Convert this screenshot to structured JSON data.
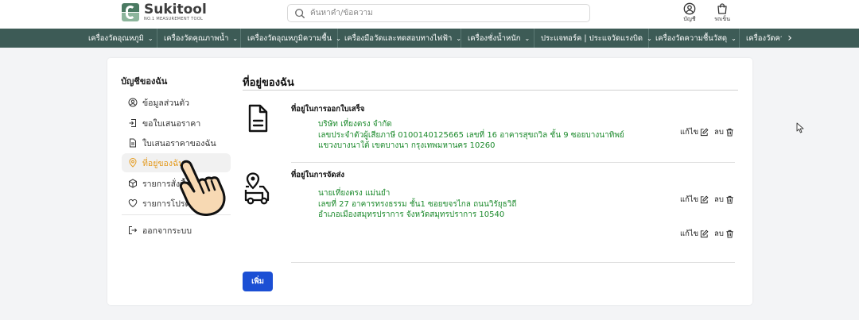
{
  "brand": {
    "name": "Sukitool",
    "tagline": "NO.1 MEASUREMENT TOOL"
  },
  "search": {
    "placeholder": "ค้นหาคำ/ข้อความ"
  },
  "header_icons": {
    "account_label": "บัญชี",
    "cart_label": "รถเข็น"
  },
  "nav": {
    "items": [
      {
        "label": "เครื่องวัดอุณหภูมิ"
      },
      {
        "label": "เครื่องวัดคุณภาพน้ำ"
      },
      {
        "label": "เครื่องวัดอุณหภูมิความชื้น"
      },
      {
        "label": "เครื่องมือวัดและทดสอบทางไฟฟ้า"
      },
      {
        "label": "เครื่องชั่งน้ำหนัก"
      },
      {
        "label": "ประแจทอร์ค | ประแจวัดแรงบิด"
      },
      {
        "label": "เครื่องวัดความชื้นวัสดุ"
      },
      {
        "label": "เครื่องวัดควา"
      }
    ]
  },
  "sidebar": {
    "title": "บัญชีของฉัน",
    "items": [
      {
        "label": "ข้อมูลส่วนตัว",
        "icon": "user-circle-icon"
      },
      {
        "label": "ขอใบเสนอราคา",
        "icon": "quote-request-icon"
      },
      {
        "label": "ใบเสนอราคาของฉัน",
        "icon": "document-icon"
      },
      {
        "label": "ที่อยู่ของฉัน",
        "icon": "location-pin-icon",
        "active": true
      },
      {
        "label": "รายการสั่งซื้อ",
        "icon": "box-icon"
      },
      {
        "label": "รายการโปรด",
        "icon": "heart-icon"
      },
      {
        "label": "ออกจากระบบ",
        "icon": "logout-icon"
      }
    ]
  },
  "main": {
    "title": "ที่อยู่ของฉัน",
    "invoice": {
      "title": "ที่อยู่ในการออกใบเสร็จ",
      "lines": [
        "บริษัท เที่ยงตรง จำกัด",
        "เลขประจำตัวผู้เสียภาษี 0100140125665  เลขที่ 16 อาคารสุขถวิล ชั้น 9  ซอยบางนาทิพย์",
        "แขวงบางนาใต้ เขตบางนา กรุงเทพมหานคร 10260"
      ]
    },
    "shipping": {
      "title": "ที่อยู่ในการจัดส่ง",
      "lines": [
        "นายเที่ยงตรง  แม่นยำ",
        "เลขที่ 27 อาคารทรงธรรม ชั้น1 ซอยขจรไกล  ถนนวิรัยุธวิถี",
        "อำเภอเมืองสมุทรปราการ จังหวัดสมุทรปราการ 10540"
      ]
    },
    "edit_label": "แก้ไข",
    "delete_label": "ลบ",
    "add_label": "เพิ่ม"
  },
  "colors": {
    "nav_bg": "#3d5b56",
    "address_green": "#1c8a2c",
    "active_orange": "#e49a1d",
    "primary_blue": "#1b4fd4"
  }
}
